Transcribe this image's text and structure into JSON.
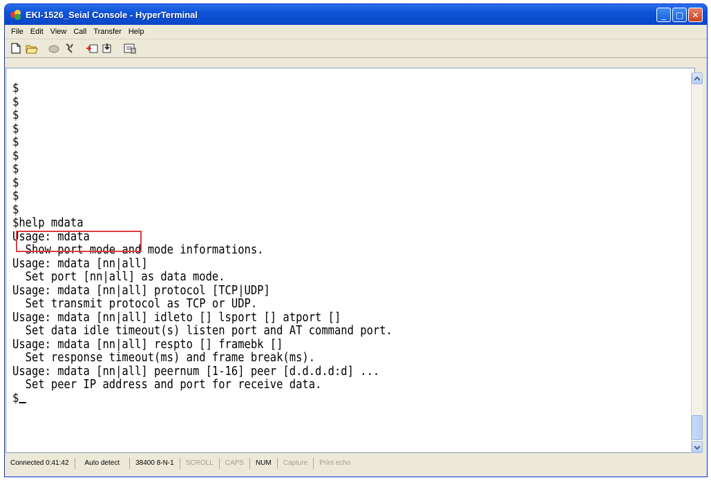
{
  "window": {
    "title": "EKI-1526_Seial Console - HyperTerminal"
  },
  "menu": [
    "File",
    "Edit",
    "View",
    "Call",
    "Transfer",
    "Help"
  ],
  "toolbar": {
    "icons": [
      "new-icon",
      "open-icon",
      "disconnect-icon",
      "properties-icon",
      "send-icon",
      "receive-icon",
      "settings-icon"
    ]
  },
  "terminal": {
    "lines": [
      "$",
      "$",
      "$",
      "$",
      "$",
      "$",
      "$",
      "$",
      "$",
      "$",
      "$help mdata",
      "Usage: mdata",
      "  Show port mode and mode informations.",
      "Usage: mdata [nn|all]",
      "  Set port [nn|all] as data mode.",
      "Usage: mdata [nn|all] protocol [TCP|UDP]",
      "  Set transmit protocol as TCP or UDP.",
      "Usage: mdata [nn|all] idleto [] lsport [] atport []",
      "  Set data idle timeout(s) listen port and AT command port.",
      "Usage: mdata [nn|all] respto [] framebk []",
      "  Set response timeout(ms) and frame break(ms).",
      "Usage: mdata [nn|all] peernum [1-16] peer [d.d.d.d:d] ...",
      "  Set peer IP address and port for receive data."
    ],
    "prompt": "$"
  },
  "status": {
    "connected": "Connected 0:41:42",
    "detect": "Auto detect",
    "port": "38400 8-N-1",
    "scroll": "SCROLL",
    "caps": "CAPS",
    "num": "NUM",
    "capture": "Capture",
    "print_echo": "Print echo"
  },
  "colors": {
    "title_bar": "#0a47c7",
    "highlight_box": "#e23a3a"
  }
}
